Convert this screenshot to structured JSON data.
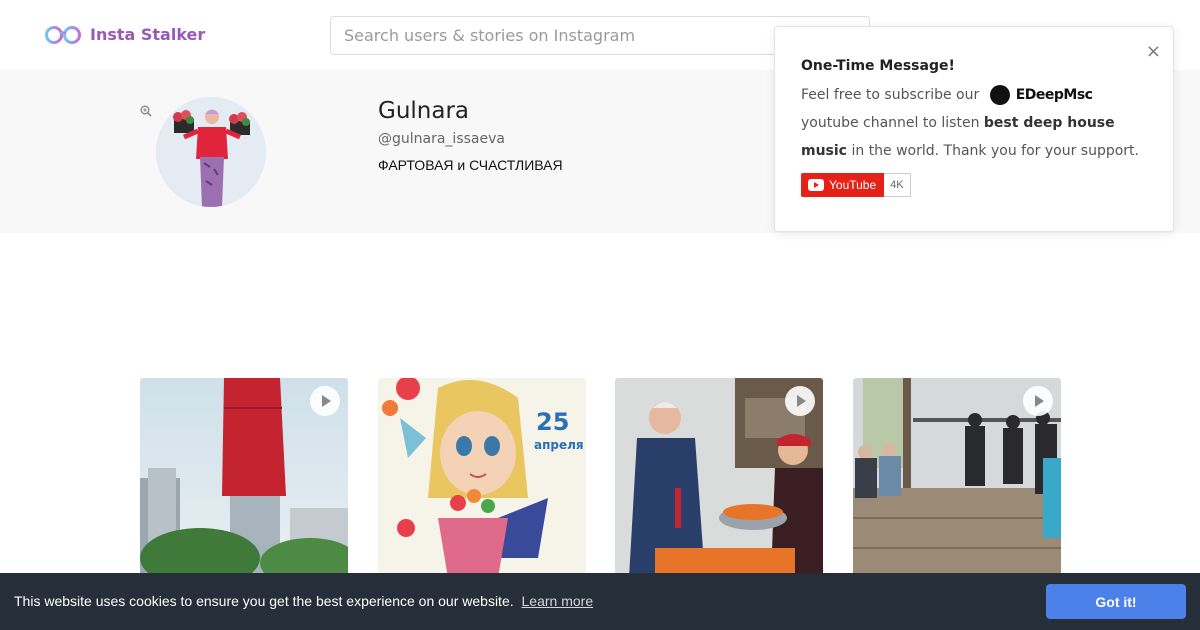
{
  "header": {
    "logo_text": "Insta Stalker",
    "search_placeholder": "Search users & stories on Instagram"
  },
  "profile": {
    "name": "Gulnara",
    "handle": "@gulnara_issaeva",
    "bio": "ФАРТОВАЯ и СЧАСТЛИВАЯ"
  },
  "popup": {
    "title": "One-Time Message!",
    "text_before": "Feel free to subscribe our",
    "brand": "EDeepMsc",
    "text_mid": "youtube channel to listen",
    "bold": "best deep house music",
    "text_after": "in the world. Thank you for your support.",
    "close": "×",
    "yt_label": "YouTube",
    "yt_count": "4K"
  },
  "posts": [
    {
      "type": "video",
      "icon": "play-icon"
    },
    {
      "type": "image",
      "caption_number": "25",
      "caption_word": "апреля"
    },
    {
      "type": "video",
      "icon": "play-icon"
    },
    {
      "type": "video",
      "icon": "play-icon"
    }
  ],
  "cookie": {
    "message": "This website uses cookies to ensure you get the best experience on our website.",
    "link": "Learn more",
    "button": "Got it!"
  },
  "colors": {
    "brand_purple": "#9b59b6",
    "cookie_bg": "#252e39",
    "cookie_button": "#4b81e8",
    "youtube_red": "#e62117"
  }
}
